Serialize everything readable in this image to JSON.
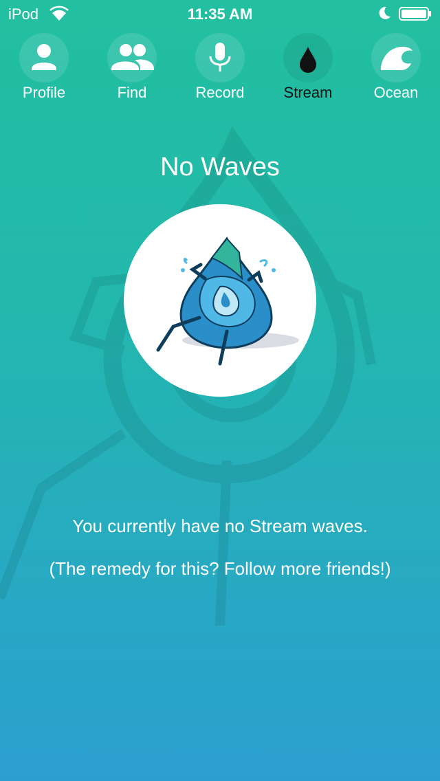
{
  "status_bar": {
    "carrier": "iPod",
    "time": "11:35 AM"
  },
  "tabs": [
    {
      "label": "Profile",
      "icon": "person-icon",
      "active": false
    },
    {
      "label": "Find",
      "icon": "people-icon",
      "active": false
    },
    {
      "label": "Record",
      "icon": "microphone-icon",
      "active": false
    },
    {
      "label": "Stream",
      "icon": "water-drop-icon",
      "active": true
    },
    {
      "label": "Ocean",
      "icon": "wave-icon",
      "active": false
    }
  ],
  "empty_state": {
    "title": "No Waves",
    "message": "You currently have no Stream waves.",
    "hint": "(The remedy for this? Follow more friends!)"
  },
  "colors": {
    "gradient_top": "#22c0a0",
    "gradient_bottom": "#2c9fd0",
    "active_tab_text": "#111111"
  }
}
